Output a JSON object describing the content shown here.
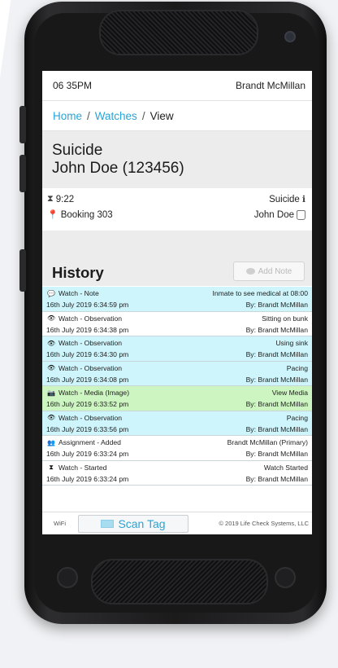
{
  "status_bar": {
    "time": "06 35PM",
    "user": "Brandt McMillan"
  },
  "breadcrumb": {
    "home": "Home",
    "sep1": "/",
    "watches": "Watches",
    "sep2": "/",
    "current": "View"
  },
  "watch": {
    "type": "Suicide",
    "inmate": "John Doe (123456)",
    "timer": "9:22",
    "type_label": "Suicide",
    "location": "Booking 303",
    "inmate_name": "John Doe"
  },
  "history": {
    "title": "History",
    "add_note_label": "Add Note",
    "entries": [
      {
        "icon": "note-icon",
        "title": "Watch - Note",
        "timestamp": "16th July 2019 6:34:59 pm",
        "detail": "Inmate to see medical at 08:00",
        "by": "By: Brandt McMillan",
        "color": "#cdf5fb"
      },
      {
        "icon": "eye-icon",
        "title": "Watch - Observation",
        "timestamp": "16th July 2019 6:34:38 pm",
        "detail": "Sitting on bunk",
        "by": "By: Brandt McMillan",
        "color": "#ffffff"
      },
      {
        "icon": "eye-icon",
        "title": "Watch - Observation",
        "timestamp": "16th July 2019 6:34:30 pm",
        "detail": "Using sink",
        "by": "By: Brandt McMillan",
        "color": "#cdf5fb"
      },
      {
        "icon": "eye-icon",
        "title": "Watch - Observation",
        "timestamp": "16th July 2019 6:34:08 pm",
        "detail": "Pacing",
        "by": "By: Brandt McMillan",
        "color": "#cdf5fb"
      },
      {
        "icon": "camera-icon",
        "title": "Watch - Media (Image)",
        "timestamp": "16th July 2019 6:33:52 pm",
        "detail": "View Media",
        "by": "By: Brandt McMillan",
        "color": "#cdf5c1"
      },
      {
        "icon": "eye-icon",
        "title": "Watch - Observation",
        "timestamp": "16th July 2019 6:33:56 pm",
        "detail": "Pacing",
        "by": "By: Brandt McMillan",
        "color": "#cdf5fb"
      },
      {
        "icon": "user-plus-icon",
        "title": "Assignment - Added",
        "timestamp": "16th July 2019 6:33:24 pm",
        "detail": "Brandt McMillan (Primary)",
        "by": "By: Brandt McMillan",
        "color": "#ffffff"
      },
      {
        "icon": "hourglass-icon",
        "title": "Watch - Started",
        "timestamp": "16th July 2019 6:33:24 pm",
        "detail": "Watch Started",
        "by": "By: Brandt McMillan",
        "color": "#ffffff"
      }
    ]
  },
  "footer": {
    "wifi": "WiFi",
    "scan_label": "Scan Tag",
    "copyright": "© 2019 Life Check Systems, LLC"
  },
  "colors": {
    "accent": "#2aa4d6",
    "note_row": "#cdf5fb",
    "media_row": "#cdf5c1"
  }
}
